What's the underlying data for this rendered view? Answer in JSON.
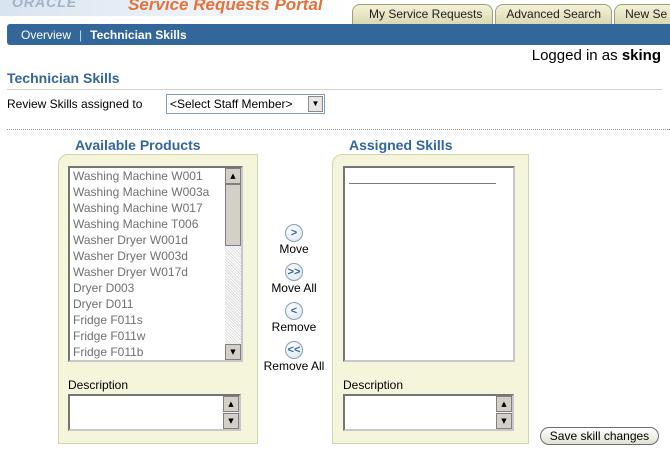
{
  "header": {
    "logo_text": "ORACLE",
    "app_title": "Service Requests Portal",
    "tabs": [
      {
        "label": "My Service Requests"
      },
      {
        "label": "Advanced Search"
      },
      {
        "label": "New Se"
      }
    ]
  },
  "subnav": {
    "overview": "Overview",
    "separator": "|",
    "current": "Technician Skills"
  },
  "user": {
    "logged_in_prefix": "Logged in as",
    "username": "sking"
  },
  "page": {
    "title": "Technician Skills",
    "review_label": "Review Skills assigned to",
    "staff_select_value": "<Select Staff Member>"
  },
  "available": {
    "title": "Available Products",
    "items": [
      "Washing Machine W001",
      "Washing Machine W003a",
      "Washing Machine W017",
      "Washing Machine T006",
      "Washer Dryer W001d",
      "Washer Dryer W003d",
      "Washer Dryer W017d",
      "Dryer D003",
      "Dryer D011",
      "Fridge F011s",
      "Fridge F011w",
      "Fridge F011b"
    ],
    "description_label": "Description"
  },
  "assigned": {
    "title": "Assigned Skills",
    "items": [],
    "description_label": "Description"
  },
  "movers": {
    "move": {
      "icon": ">",
      "label": "Move"
    },
    "move_all": {
      "icon": ">>",
      "label": "Move All"
    },
    "remove": {
      "icon": "<",
      "label": "Remove"
    },
    "remove_all": {
      "icon": "<<",
      "label": "Remove All"
    }
  },
  "actions": {
    "save": "Save skill changes"
  },
  "colors": {
    "header_blue": "#336699",
    "brand_orange": "#e3733a",
    "panel_beige": "#f5f5dc"
  }
}
